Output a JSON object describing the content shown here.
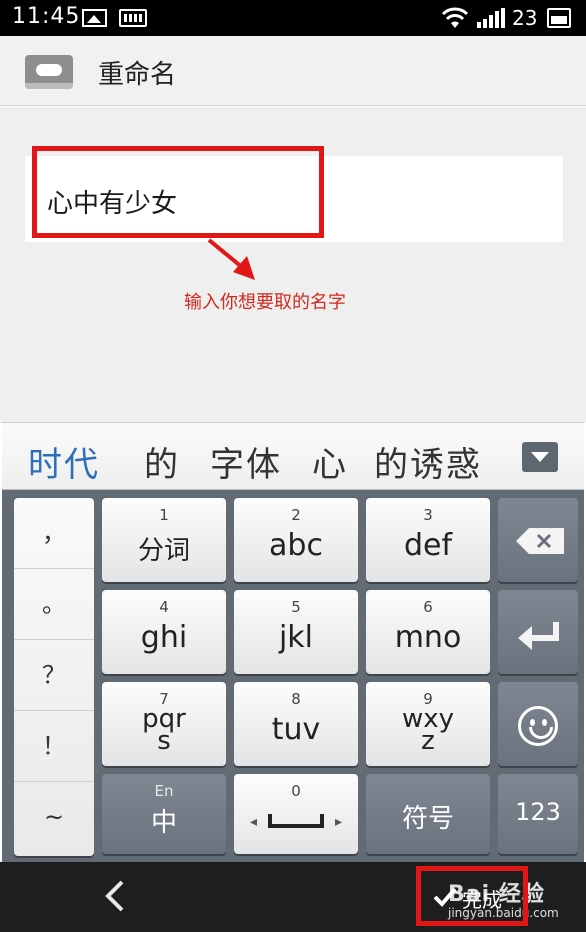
{
  "status_bar": {
    "time": "11:45",
    "battery": "23"
  },
  "header": {
    "title": "重命名"
  },
  "input": {
    "value": "心中有少女"
  },
  "annotation": "输入你想要取的名字",
  "candidates": [
    "时代",
    "的",
    "字体",
    "心",
    "的诱惑"
  ],
  "punctuation": [
    "，",
    "。",
    "？",
    "！",
    "~"
  ],
  "keys": {
    "k1": {
      "num": "1",
      "label": "分词"
    },
    "k2": {
      "num": "2",
      "label": "abc"
    },
    "k3": {
      "num": "3",
      "label": "def"
    },
    "k4": {
      "num": "4",
      "label": "ghi"
    },
    "k5": {
      "num": "5",
      "label": "jkl"
    },
    "k6": {
      "num": "6",
      "label": "mno"
    },
    "k7": {
      "num": "7",
      "label": "pqr",
      "label2": "s"
    },
    "k8": {
      "num": "8",
      "label": "tuv"
    },
    "k9": {
      "num": "9",
      "label": "wxy",
      "label2": "z"
    },
    "lang": {
      "top": "En",
      "label": "中"
    },
    "space": {
      "num": "0"
    },
    "symbol": {
      "label": "符号"
    },
    "numeric": {
      "label": "123"
    }
  },
  "nav": {
    "done_label": "完成"
  },
  "watermark": {
    "main": "Bai 经验",
    "sub": "jingyan.baidu.com"
  },
  "colors": {
    "accent": "#2d6fb9",
    "highlight": "#e11717",
    "annotation": "#d42a1e",
    "keyboard_bg": "#626a74"
  }
}
